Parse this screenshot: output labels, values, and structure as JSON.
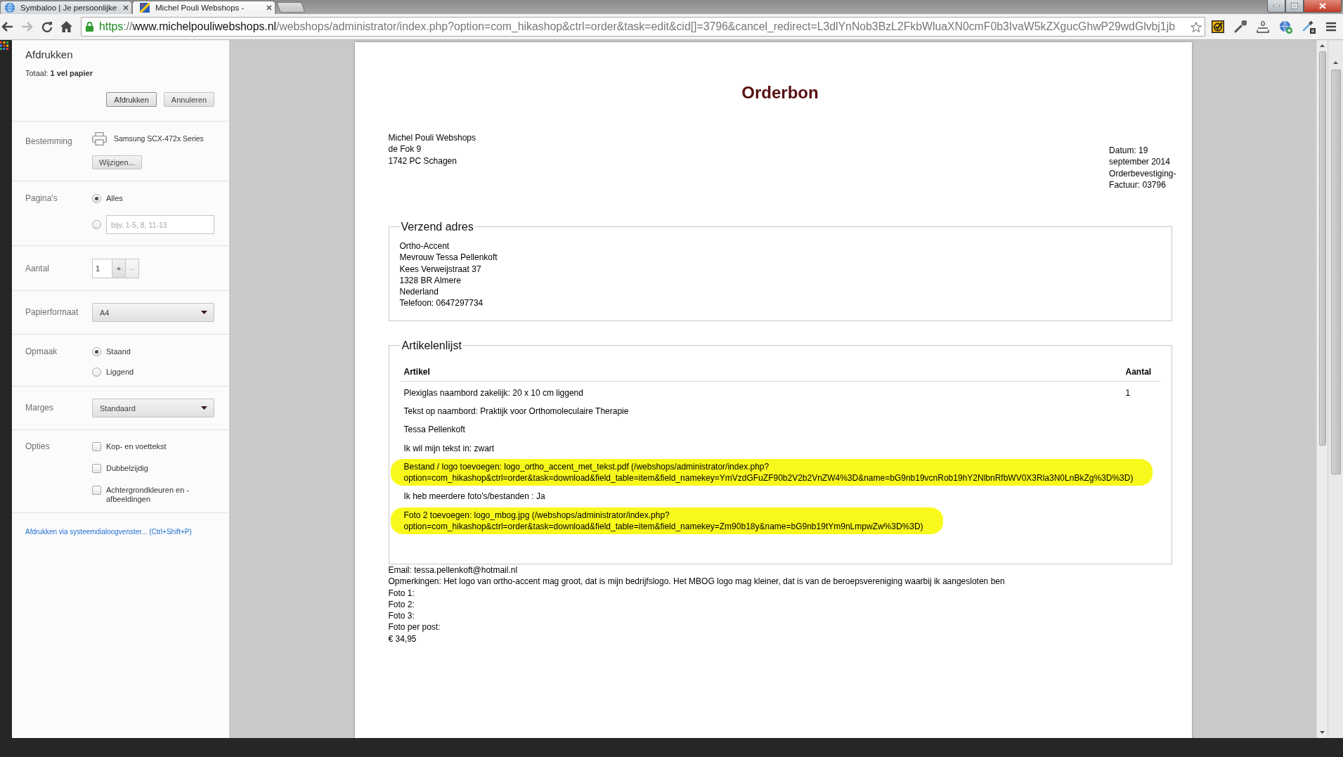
{
  "browser": {
    "tabs": [
      {
        "title": "Symbaloo | Je persoonlijke",
        "selected": false
      },
      {
        "title": "Michel Pouli Webshops -",
        "selected": true
      }
    ],
    "url": [
      {
        "kind": "scheme",
        "text": "https"
      },
      {
        "kind": "separator",
        "text": "://"
      },
      {
        "kind": "host",
        "text": "www.michelpouliwebshops.nl"
      },
      {
        "kind": "path",
        "text": "/webshops/administrator/index.php?option=com_hikashop&ctrl=order&task=edit&cid[]=3796&cancel_redirect=L3dlYnNob3BzL2FkbWluaXN0cmF0b3IvaW5kZXgucGhwP29wdGlvbj1jb"
      }
    ]
  },
  "print_panel": {
    "title": "Afdrukken",
    "total": "Totaal: **1 vel papier**",
    "buttons": [
      {
        "kind": "primary",
        "label": "Afdrukken"
      },
      {
        "kind": "secondary",
        "label": "Annuleren"
      }
    ],
    "sections": [
      {
        "kind": "destination",
        "label": "Bestemming",
        "printer": "Samsung SCX-472x Series",
        "button": "Wijzigen..."
      },
      {
        "kind": "pages",
        "label": "Pagina's",
        "options": [
          {
            "kind": "label",
            "label": "Alles",
            "selected": true
          },
          {
            "kind": "field",
            "placeholder": "bijv. 1-5, 8, 11-13",
            "selected": false
          }
        ]
      },
      {
        "kind": "copies",
        "label": "Aantal",
        "value": "1",
        "steps": [
          {
            "label": "+",
            "disabled": false
          },
          {
            "label": "–",
            "disabled": true
          }
        ]
      },
      {
        "kind": "select",
        "label": "Papierformaat",
        "value": "A4"
      },
      {
        "kind": "radios",
        "label": "Opmaak",
        "options": [
          {
            "kind": "label",
            "label": "Staand",
            "selected": true
          },
          {
            "kind": "label",
            "label": "Liggend",
            "selected": false
          }
        ]
      },
      {
        "kind": "select",
        "label": "Marges",
        "value": "Standaard"
      },
      {
        "kind": "checkboxes",
        "label": "Opties",
        "options": [
          {
            "label": "Kop- en voettekst",
            "checked": false
          },
          {
            "label": "Dubbelzijdig",
            "checked": false
          },
          {
            "label": "Achtergrondkleuren en - afbeeldingen",
            "checked": false
          }
        ]
      }
    ],
    "link": "Afdrukken via systeemdialoogvenster... (Ctrl+Shift+P)"
  },
  "document": {
    "title": "Orderbon",
    "sender": [
      "Michel Pouli Webshops",
      "de Fok 9",
      "1742 PC Schagen"
    ],
    "order_info": [
      "Datum: 19",
      "september 2014",
      "Orderbevestiging-",
      "Factuur: 03796"
    ],
    "shipping": {
      "legend": "Verzend adres",
      "lines": [
        "Ortho-Accent",
        "Mevrouw Tessa Pellenkoft",
        "Kees Verweijstraat 37",
        "1328 BR Almere",
        "Nederland",
        "Telefoon: 0647297734"
      ]
    },
    "items": {
      "legend": "Artikelenlijst",
      "columns": [
        "Artikel",
        "Aantal"
      ],
      "rows": [
        [
          "Plexiglas naambord zakelijk: 20 x 10 cm liggend",
          "1"
        ]
      ],
      "details": [
        {
          "lines": [
            "Tekst op naambord: Praktijk voor Orthomoleculaire Therapie"
          ],
          "highlighted": false
        },
        {
          "lines": [
            "Tessa Pellenkoft"
          ],
          "highlighted": false
        },
        {
          "lines": [
            "Ik wil mijn tekst in: zwart"
          ],
          "highlighted": false
        },
        {
          "lines": [
            "Bestand / logo toevoegen: logo_ortho_accent_met_tekst.pdf (/webshops/administrator/index.php?",
            "option=com_hikashop&ctrl=order&task=download&field_table=item&field_namekey=YmVzdGFuZF90b2V2b2VnZW4%3D&name=bG9nb19vcnRob19hY2NlbnRfbWV0X3Rla3N0LnBkZg%3D%3D)"
          ],
          "highlighted": true
        },
        {
          "lines": [
            "Ik heb meerdere foto's/bestanden : Ja"
          ],
          "highlighted": false
        },
        {
          "lines": [
            "Foto 2 toevoegen: logo_mbog.jpg (/webshops/administrator/index.php?",
            "option=com_hikashop&ctrl=order&task=download&field_table=item&field_namekey=Zm90b18y&name=bG9nb19tYm9nLmpwZw%3D%3D)"
          ],
          "highlighted": true
        }
      ]
    },
    "footer": [
      "Email: tessa.pellenkoft@hotmail.nl",
      "Opmerkingen: Het logo van ortho-accent mag groot, dat is mijn bedrijfslogo. Het MBOG logo mag kleiner, dat is van de beroepsvereniging waarbij ik aangesloten ben",
      "Foto 1:",
      "Foto 2:",
      "Foto 3:",
      "Foto per post:",
      "€ 34,95"
    ]
  }
}
